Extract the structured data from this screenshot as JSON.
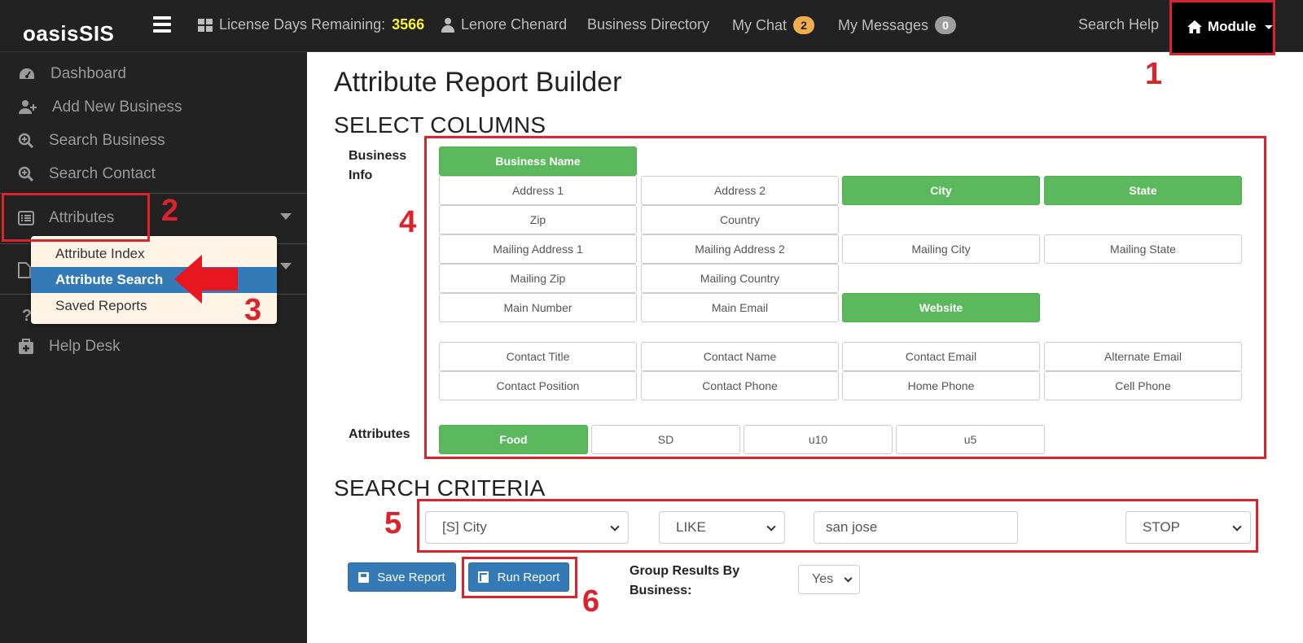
{
  "brand": "oasisSIS",
  "topnav": {
    "license_label": "License Days Remaining:",
    "license_value": "3566",
    "user_name": "Lenore Chenard",
    "business_directory": "Business Directory",
    "my_chat": "My Chat",
    "my_chat_count": "2",
    "my_messages": "My Messages",
    "my_messages_count": "0",
    "search_help": "Search Help",
    "module": "Module"
  },
  "sidebar": {
    "items": [
      {
        "label": "Dashboard",
        "icon": "dashboard-icon"
      },
      {
        "label": "Add New Business",
        "icon": "user-plus-icon"
      },
      {
        "label": "Search Business",
        "icon": "search-plus-icon"
      },
      {
        "label": "Search Contact",
        "icon": "search-plus-icon"
      },
      {
        "label": "Attributes",
        "icon": "list-icon"
      },
      {
        "label": "Help Desk",
        "icon": "medkit-icon"
      }
    ],
    "attributes_menu": [
      "Attribute Index",
      "Attribute Search",
      "Saved Reports"
    ]
  },
  "annotations": [
    "1",
    "2",
    "3",
    "4",
    "5",
    "6"
  ],
  "colors": {
    "annotation": "#d9232d",
    "selected": "#5cb85c",
    "primary": "#337ab7",
    "license": "#f7f53b"
  },
  "main": {
    "title": "Attribute Report Builder",
    "select_columns": "SELECT COLUMNS",
    "business_info_label": "Business Info",
    "attributes_label": "Attributes",
    "columns": {
      "business_name": "Business Name",
      "address1": "Address 1",
      "address2": "Address 2",
      "city": "City",
      "state": "State",
      "zip": "Zip",
      "country": "Country",
      "mailing_address1": "Mailing Address 1",
      "mailing_address2": "Mailing Address 2",
      "mailing_city": "Mailing City",
      "mailing_state": "Mailing State",
      "mailing_zip": "Mailing Zip",
      "mailing_country": "Mailing Country",
      "main_number": "Main Number",
      "main_email": "Main Email",
      "website": "Website",
      "contact_title": "Contact Title",
      "contact_name": "Contact Name",
      "contact_email": "Contact Email",
      "alternate_email": "Alternate Email",
      "contact_position": "Contact Position",
      "contact_phone": "Contact Phone",
      "home_phone": "Home Phone",
      "cell_phone": "Cell Phone"
    },
    "attributes": {
      "food": "Food",
      "sd": "SD",
      "u10": "u10",
      "u5": "u5"
    },
    "search_criteria": "SEARCH CRITERIA",
    "criteria": {
      "field": "[S] City",
      "operator": "LIKE",
      "value": "san jose",
      "action": "STOP"
    },
    "save_report": "Save Report",
    "run_report": "Run Report",
    "group_label": "Group Results By Business:",
    "group_value": "Yes"
  }
}
